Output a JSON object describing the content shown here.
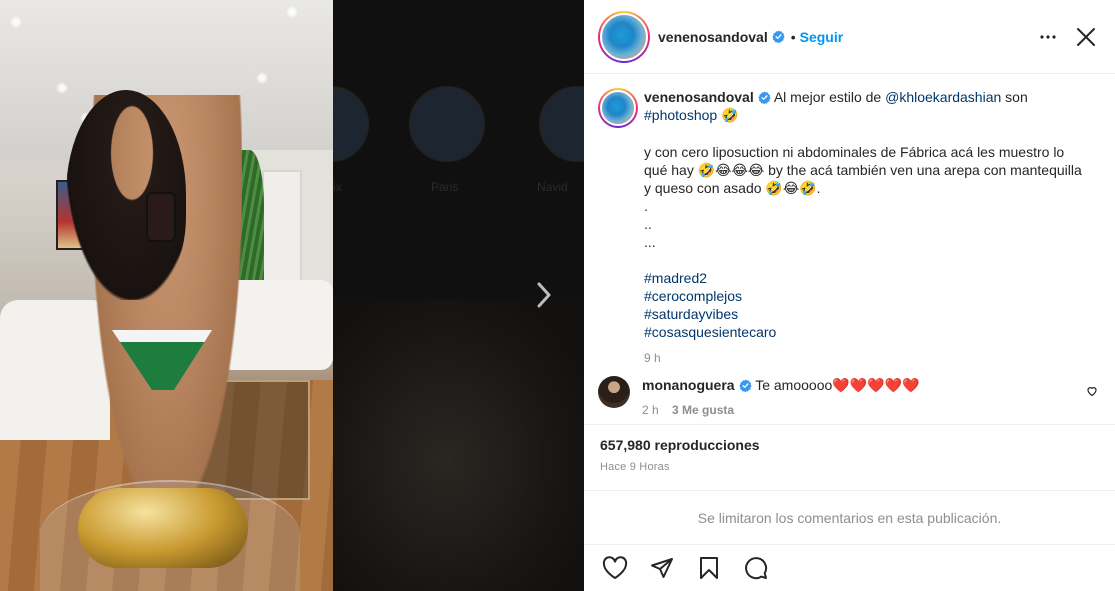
{
  "header": {
    "username": "venenosandoval",
    "separator": "•",
    "follow_label": "Seguir"
  },
  "caption": {
    "username": "venenosandoval",
    "lead_text": "Al mejor estilo de",
    "mention": "@khloekardashian",
    "lead_after": "son",
    "hashtag_first": "#photoshop",
    "emoji_first": "🤣",
    "paragraph": "y con cero liposuction ni abdominales de Fábrica acá les muestro lo qué hay 🤣😂😂😂 by the acá también ven una arepa con mantequilla y queso con asado 🤣😂🤣.",
    "dots": [
      ".",
      "..",
      "..."
    ],
    "hashtags": [
      "#madred2",
      "#cerocomplejos",
      "#saturdayvibes",
      "#cosasquesientecaro"
    ],
    "time": "9 h"
  },
  "comment": {
    "username": "monanoguera",
    "text": "Te amooooo",
    "hearts": "❤️❤️❤️❤️❤️",
    "time": "2 h",
    "likes": "3 Me gusta"
  },
  "stats": {
    "views": "657,980 reproducciones",
    "ago": "Hace 9 Horas"
  },
  "limited_comments": "Se limitaron los comentarios en esta publicación.",
  "backdrop": {
    "labels": [
      "Paris",
      "Navid",
      "ix"
    ]
  },
  "icons": {
    "verified": "verified-badge-icon",
    "more": "more-options-icon",
    "close": "close-icon",
    "next": "chevron-right-icon",
    "like": "heart-icon",
    "share": "send-icon",
    "save": "bookmark-icon",
    "comment": "comment-icon"
  },
  "colors": {
    "accent": "#0095f6",
    "link": "#00376b",
    "muted": "#8e8e8e",
    "verified": "#3897f0"
  }
}
